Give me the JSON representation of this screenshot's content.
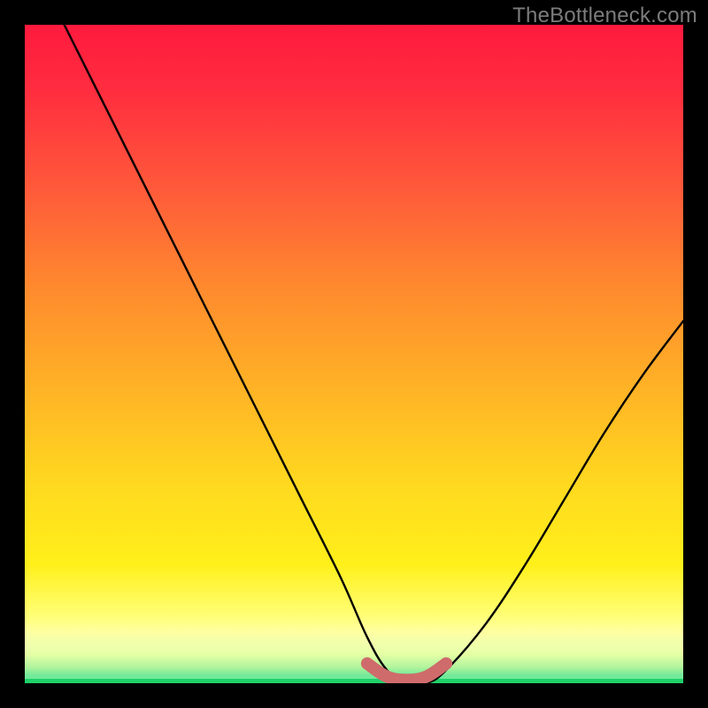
{
  "watermark": "TheBottleneck.com",
  "chart_data": {
    "type": "line",
    "title": "",
    "xlabel": "",
    "ylabel": "",
    "xlim": [
      0,
      100
    ],
    "ylim": [
      0,
      100
    ],
    "series": [
      {
        "name": "bottleneck-curve",
        "x": [
          6,
          12,
          18,
          24,
          30,
          36,
          42,
          48,
          52,
          55,
          58,
          61,
          64,
          70,
          76,
          82,
          88,
          94,
          100
        ],
        "y": [
          100,
          88,
          76,
          64,
          52,
          40,
          28,
          16,
          7,
          2,
          0,
          0,
          2,
          9,
          18,
          28,
          38,
          47,
          55
        ]
      },
      {
        "name": "optimal-range-marker",
        "x": [
          52,
          55,
          58,
          61,
          64
        ],
        "y": [
          3,
          1,
          0.5,
          1,
          3
        ]
      }
    ],
    "colors": {
      "curve": "#000000",
      "marker": "#cf6b6b",
      "green_line": "#1fd169"
    }
  }
}
